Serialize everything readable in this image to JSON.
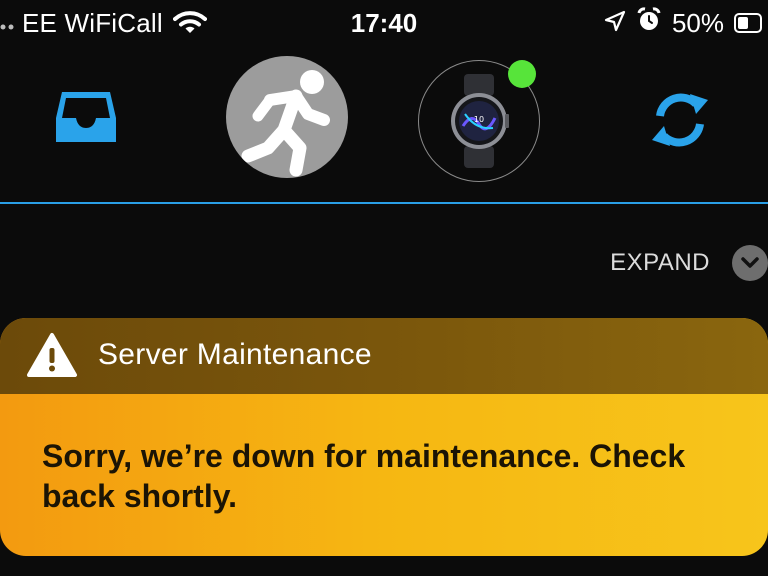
{
  "status_bar": {
    "carrier": "EE WiFiCall",
    "time": "17:40",
    "battery_percent": "50%",
    "battery_level": 0.5,
    "icons": [
      "signal-dots-icon",
      "wifi-icon",
      "location-arrow-icon",
      "alarm-clock-icon",
      "battery-icon"
    ]
  },
  "nav": {
    "items": [
      {
        "name": "inbox",
        "icon": "inbox-tray-icon"
      },
      {
        "name": "activity",
        "icon": "running-person-icon"
      },
      {
        "name": "device",
        "icon": "smartwatch-icon",
        "status": "connected"
      },
      {
        "name": "sync",
        "icon": "sync-arrows-icon"
      }
    ],
    "accent_color": "#2a9fe6",
    "connected_color": "#57e43a"
  },
  "expand": {
    "label": "EXPAND",
    "icon": "chevron-down-icon"
  },
  "alert": {
    "title": "Server Maintenance",
    "message": "Sorry, we’re down for maintenance. Check back shortly.",
    "icon": "warning-triangle-icon",
    "header_color": "#7a560c",
    "body_color": "#f6b712"
  }
}
